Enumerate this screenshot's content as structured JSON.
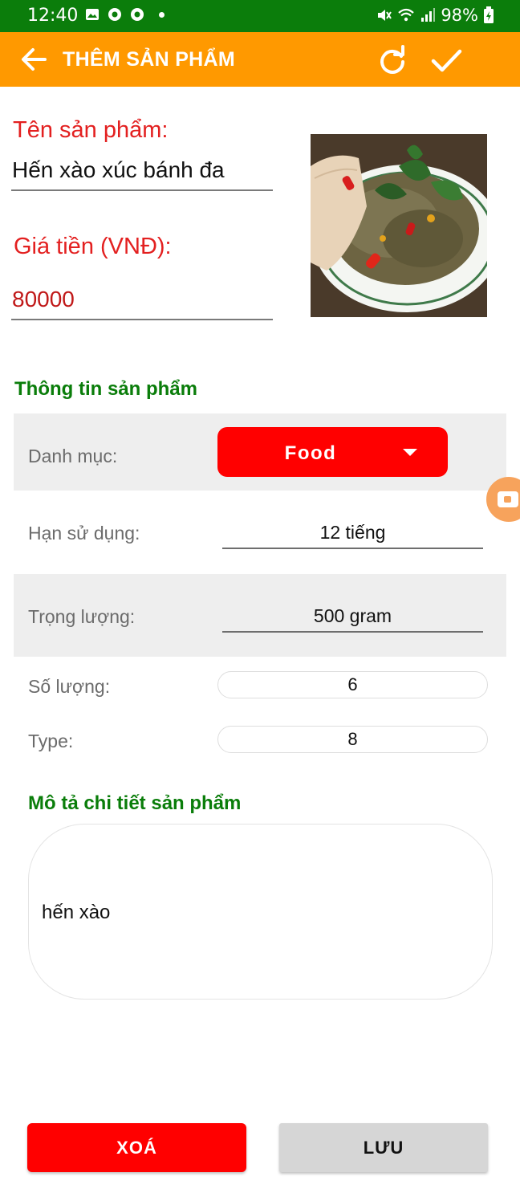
{
  "status_bar": {
    "time": "12:40",
    "battery": "98%"
  },
  "app_bar": {
    "title": "THÊM SẢN PHẨM"
  },
  "product": {
    "name_label": "Tên sản phẩm:",
    "name_value": "Hến xào xúc bánh đa",
    "price_label": "Giá tiền (VNĐ):",
    "price_value": "80000"
  },
  "info": {
    "section_title": "Thông tin sản phẩm",
    "category_label": "Danh mục:",
    "category_value": "Food",
    "expiry_label": "Hạn sử dụng:",
    "expiry_value": "12 tiếng",
    "weight_label": "Trọng lượng:",
    "weight_value": "500 gram",
    "quantity_label": "Số lượng:",
    "quantity_value": "6",
    "type_label": "Type:",
    "type_value": "8"
  },
  "description": {
    "section_title": "Mô tả chi tiết sản phẩm",
    "value": "hến xào"
  },
  "buttons": {
    "delete_label": "XOÁ",
    "save_label": "LƯU"
  },
  "colors": {
    "status_bar": "#0b7d0b",
    "app_bar": "#ff9900",
    "label_red": "#e32020",
    "section_green": "#0a7d0a",
    "dropdown_red": "#ff0000",
    "save_gray": "#d6d6d6"
  }
}
